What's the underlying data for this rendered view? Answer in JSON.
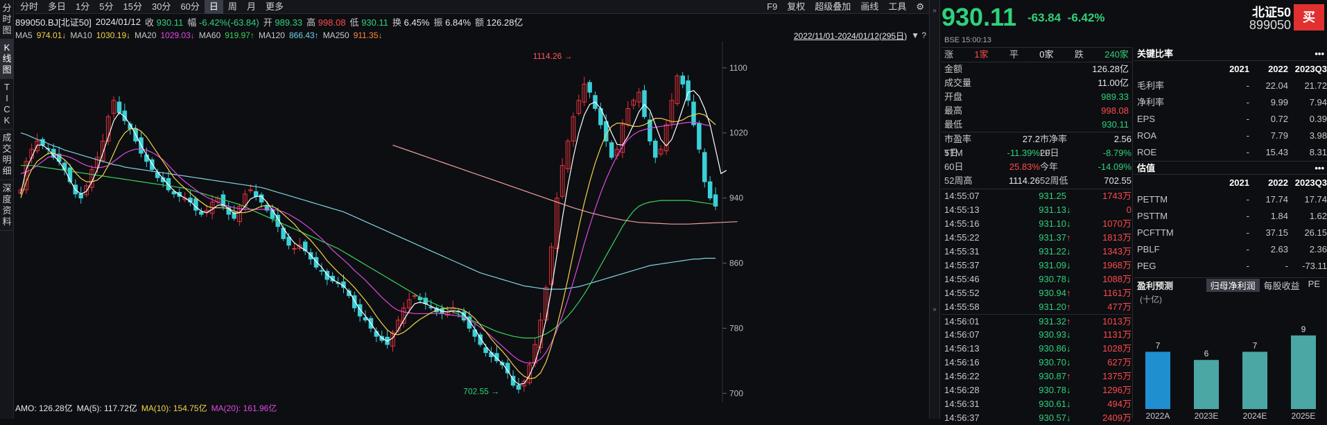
{
  "toolbar": {
    "periods": [
      "分时",
      "多日",
      "1分",
      "5分",
      "15分",
      "30分",
      "60分",
      "日",
      "周",
      "月",
      "更多"
    ],
    "active_period": "日",
    "right": [
      "F9",
      "复权",
      "超级叠加",
      "画线",
      "工具"
    ]
  },
  "leftnav": [
    "分时图",
    "K线图",
    "TICK",
    "成交明细",
    "深度资料"
  ],
  "info": {
    "code_name": "899050.BJ[北证50]",
    "date": "2024/01/12",
    "close_label": "收",
    "close": "930.11",
    "amp_label": "幅",
    "amp": "-6.42%(-63.84)",
    "open_label": "开",
    "open": "989.33",
    "high_label": "高",
    "high": "998.08",
    "low_label": "低",
    "low": "930.11",
    "turnover_label": "换",
    "turnover": "6.45%",
    "swing_label": "振",
    "swing": "6.84%",
    "amount_label": "额",
    "amount": "126.28亿"
  },
  "ma": {
    "ma5": "MA5",
    "ma5v": "974.01↓",
    "ma10": "MA10",
    "ma10v": "1030.19↓",
    "ma20": "MA20",
    "ma20v": "1029.03↓",
    "ma60": "MA60",
    "ma60v": "919.97↑",
    "ma120": "MA120",
    "ma120v": "866.43↑",
    "ma250": "MA250",
    "ma250v": "911.35↓",
    "range": "2022/11/01-2024/01/12(295日)"
  },
  "chart_data": {
    "type": "candlestick",
    "y_ticks": [
      "1100",
      "1020",
      "940",
      "860",
      "780",
      "700"
    ],
    "ylim": [
      696,
      1122
    ],
    "max_label": "1114.26",
    "min_label": "702.55",
    "closes": [
      950,
      985,
      1000,
      1010,
      1005,
      1000,
      990,
      985,
      975,
      960,
      945,
      940,
      955,
      975,
      990,
      1010,
      1040,
      1060,
      1045,
      1035,
      1025,
      1010,
      995,
      985,
      975,
      965,
      960,
      950,
      945,
      942,
      940,
      935,
      925,
      920,
      925,
      935,
      940,
      930,
      920,
      915,
      930,
      945,
      950,
      942,
      935,
      925,
      915,
      905,
      890,
      882,
      878,
      882,
      875,
      865,
      855,
      850,
      840,
      838,
      835,
      830,
      820,
      805,
      795,
      790,
      780,
      770,
      765,
      760,
      775,
      790,
      805,
      815,
      820,
      815,
      810,
      805,
      800,
      798,
      800,
      805,
      800,
      790,
      780,
      770,
      760,
      750,
      745,
      740,
      735,
      725,
      710,
      705,
      715,
      735,
      760,
      790,
      830,
      880,
      940,
      980,
      1010,
      1040,
      1060,
      1080,
      1070,
      1050,
      1030,
      1010,
      990,
      1000,
      1030,
      1050,
      1060,
      1070,
      1040,
      1010,
      990,
      1000,
      1030,
      1060,
      1090,
      1080,
      1060,
      1030,
      1000,
      960,
      940,
      930
    ],
    "ma5": [
      945,
      975,
      990,
      1005,
      1005,
      1000,
      992,
      985,
      975,
      962,
      950,
      945,
      948,
      960,
      975,
      995,
      1015,
      1035,
      1045,
      1040,
      1030,
      1018,
      1005,
      993,
      982,
      972,
      964,
      956,
      949,
      944,
      940,
      936,
      929,
      924,
      922,
      926,
      931,
      932,
      927,
      921,
      922,
      930,
      939,
      942,
      942,
      935,
      925,
      915,
      903,
      893,
      885,
      880,
      876,
      870,
      862,
      855,
      846,
      840,
      836,
      832,
      825,
      814,
      803,
      795,
      786,
      776,
      768,
      764,
      768,
      778,
      790,
      801,
      810,
      812,
      810,
      807,
      804,
      801,
      800,
      801,
      801,
      797,
      789,
      779,
      768,
      758,
      750,
      743,
      737,
      728,
      717,
      711,
      712,
      722,
      738,
      760,
      790,
      828,
      870,
      915,
      955,
      990,
      1020,
      1042,
      1055,
      1058,
      1050,
      1036,
      1020,
      1006,
      1005,
      1016,
      1030,
      1046,
      1055,
      1048,
      1030,
      1012,
      1004,
      1012,
      1030,
      1050,
      1070,
      1072,
      1065,
      1050,
      1030,
      1000,
      970,
      974
    ],
    "ma10": [
      940,
      960,
      975,
      985,
      990,
      995,
      995,
      992,
      987,
      980,
      971,
      964,
      960,
      960,
      962,
      968,
      980,
      995,
      1010,
      1020,
      1025,
      1026,
      1022,
      1015,
      1005,
      995,
      985,
      975,
      965,
      958,
      952,
      946,
      940,
      935,
      930,
      928,
      928,
      928,
      927,
      924,
      922,
      922,
      924,
      927,
      930,
      931,
      930,
      926,
      920,
      914,
      908,
      900,
      894,
      888,
      880,
      872,
      863,
      856,
      849,
      843,
      837,
      830,
      822,
      814,
      805,
      795,
      786,
      778,
      773,
      772,
      775,
      780,
      786,
      791,
      795,
      799,
      802,
      804,
      805,
      805,
      804,
      802,
      798,
      792,
      784,
      776,
      767,
      759,
      752,
      744,
      735,
      727,
      721,
      718,
      719,
      725,
      738,
      758,
      782,
      810,
      840,
      872,
      904,
      934,
      960,
      983,
      1002,
      1018,
      1028,
      1032,
      1032,
      1030,
      1028,
      1028,
      1030,
      1034,
      1038,
      1038,
      1036,
      1034,
      1034,
      1036,
      1040,
      1042,
      1044,
      1042,
      1036,
      1030
    ],
    "ma20": [
      970,
      972,
      975,
      980,
      985,
      990,
      992,
      993,
      992,
      990,
      987,
      983,
      980,
      978,
      977,
      978,
      980,
      985,
      990,
      995,
      998,
      1000,
      1000,
      999,
      996,
      992,
      987,
      980,
      973,
      966,
      960,
      955,
      950,
      945,
      941,
      938,
      935,
      932,
      930,
      928,
      927,
      926,
      926,
      926,
      926,
      926,
      926,
      925,
      923,
      920,
      916,
      912,
      907,
      902,
      896,
      890,
      883,
      876,
      870,
      864,
      858,
      851,
      845,
      839,
      832,
      825,
      818,
      812,
      806,
      802,
      800,
      799,
      798,
      798,
      798,
      798,
      798,
      798,
      797,
      796,
      795,
      793,
      790,
      786,
      781,
      776,
      770,
      764,
      758,
      752,
      746,
      741,
      738,
      737,
      738,
      742,
      750,
      762,
      777,
      795,
      815,
      837,
      860,
      884,
      906,
      927,
      946,
      963,
      978,
      992,
      1003,
      1012,
      1018,
      1022,
      1024,
      1026,
      1027,
      1028,
      1029,
      1030,
      1031,
      1032,
      1033,
      1033,
      1032,
      1030,
      1029
    ],
    "ma60": [
      980,
      980,
      980,
      979,
      978,
      977,
      976,
      975,
      974,
      973,
      972,
      971,
      970,
      969,
      968,
      967,
      966,
      965,
      964,
      963,
      962,
      961,
      960,
      959,
      958,
      957,
      956,
      955,
      954,
      953,
      952,
      950,
      948,
      946,
      944,
      942,
      940,
      938,
      936,
      934,
      932,
      929,
      926,
      923,
      920,
      917,
      914,
      911,
      908,
      905,
      902,
      899,
      896,
      893,
      890,
      887,
      884,
      881,
      878,
      874,
      870,
      866,
      862,
      858,
      854,
      850,
      846,
      842,
      838,
      834,
      830,
      826,
      822,
      818,
      815,
      812,
      809,
      806,
      803,
      800,
      797,
      794,
      791,
      788,
      785,
      782,
      779,
      776,
      774,
      772,
      770,
      769,
      768,
      768,
      768,
      770,
      773,
      777,
      782,
      788,
      795,
      803,
      812,
      822,
      833,
      845,
      857,
      869,
      881,
      893,
      905,
      915,
      924,
      930,
      933,
      935,
      936,
      937,
      937,
      937,
      937,
      937,
      937,
      936,
      935,
      934,
      933,
      932
    ],
    "ma120": [
      1020,
      1018,
      1015,
      1012,
      1010,
      1007,
      1004,
      1002,
      999,
      997,
      995,
      993,
      991,
      989,
      987,
      985,
      983,
      981,
      980,
      978,
      977,
      976,
      975,
      974,
      973,
      972,
      971,
      970,
      969,
      968,
      967,
      966,
      965,
      964,
      963,
      962,
      961,
      960,
      959,
      958,
      957,
      956,
      955,
      954,
      953,
      951,
      949,
      947,
      945,
      943,
      941,
      939,
      937,
      935,
      933,
      931,
      929,
      927,
      925,
      923,
      920,
      917,
      914,
      911,
      908,
      905,
      902,
      899,
      896,
      893,
      890,
      887,
      884,
      881,
      878,
      875,
      872,
      869,
      866,
      863,
      860,
      857,
      854,
      851,
      848,
      846,
      844,
      842,
      840,
      838,
      836,
      834,
      832,
      831,
      830,
      829,
      828,
      828,
      828,
      828,
      829,
      830,
      831,
      833,
      835,
      837,
      839,
      841,
      843,
      845,
      847,
      849,
      851,
      853,
      855,
      857,
      858,
      859,
      860,
      861,
      862,
      863,
      864,
      865,
      865,
      866,
      866,
      866
    ],
    "ma250": [
      null,
      null,
      null,
      null,
      null,
      null,
      null,
      null,
      null,
      null,
      null,
      null,
      null,
      null,
      null,
      null,
      null,
      null,
      null,
      null,
      null,
      null,
      null,
      null,
      null,
      null,
      null,
      null,
      null,
      null,
      null,
      null,
      null,
      null,
      null,
      null,
      null,
      null,
      null,
      null,
      null,
      null,
      null,
      null,
      null,
      null,
      null,
      null,
      null,
      null,
      null,
      null,
      null,
      null,
      null,
      null,
      null,
      null,
      null,
      null,
      null,
      null,
      null,
      null,
      null,
      null,
      null,
      null,
      null,
      null,
      null,
      null,
      null,
      null,
      null,
      null,
      null,
      null,
      null,
      null,
      null,
      null,
      null,
      null,
      null,
      null,
      null,
      null,
      null,
      null,
      null,
      null,
      null,
      null,
      null,
      null,
      null,
      null,
      null,
      null,
      null,
      null,
      null,
      null,
      null,
      null,
      null,
      null,
      null,
      null,
      null,
      null,
      null,
      null,
      null,
      null,
      null,
      null,
      null,
      null,
      null,
      null,
      null,
      null,
      null,
      null,
      null,
      null
    ],
    "ma250_line": [
      1005,
      998,
      991,
      984,
      977,
      970,
      963,
      956,
      949,
      942,
      935,
      928,
      922,
      917,
      913,
      910,
      909,
      908,
      908,
      909,
      910,
      911
    ]
  },
  "amo": {
    "amo": "AMO: 126.28亿",
    "ma5": "MA(5): 117.72亿",
    "ma10": "MA(10): 154.75亿",
    "ma20": "MA(20): 161.96亿"
  },
  "quote": {
    "price": "930.11",
    "change": "-63.84",
    "pct": "-6.42%",
    "name": "北证50",
    "code": "899050",
    "buy": "买",
    "exchange": "BSE",
    "time": "15:00:13"
  },
  "stats": {
    "up_label": "涨",
    "up": "1家",
    "flat_label": "平",
    "flat": "0家",
    "down_label": "跌",
    "down": "240家",
    "rows": [
      {
        "k": "金额",
        "v": "126.28亿",
        "c": "white"
      },
      {
        "k": "成交量",
        "v": "11.00亿",
        "c": "white"
      },
      {
        "k": "开盘",
        "v": "989.33",
        "c": "green"
      },
      {
        "k": "最高",
        "v": "998.08",
        "c": "red"
      },
      {
        "k": "最低",
        "v": "930.11",
        "c": "green"
      }
    ],
    "grid": [
      [
        "市盈率TTM",
        "27.2",
        "市净率LF",
        "2.56",
        "white",
        "white"
      ],
      [
        "5日",
        "-11.39%",
        "20日",
        "-8.79%",
        "green",
        "green"
      ],
      [
        "60日",
        "25.83%",
        "今年",
        "-14.09%",
        "red",
        "green"
      ],
      [
        "52周高",
        "1114.26",
        "52周低",
        "702.55",
        "white",
        "white"
      ]
    ]
  },
  "ticks": [
    [
      "14:55:07",
      "931.25",
      "",
      "1743万"
    ],
    [
      "14:55:13",
      "931.13",
      "↓",
      "0"
    ],
    [
      "14:55:16",
      "931.10",
      "↓",
      "1070万"
    ],
    [
      "14:55:22",
      "931.37",
      "↑",
      "1813万"
    ],
    [
      "14:55:31",
      "931.22",
      "↓",
      "1343万"
    ],
    [
      "14:55:37",
      "931.09",
      "↓",
      "1968万"
    ],
    [
      "14:55:46",
      "930.78",
      "↓",
      "1088万"
    ],
    [
      "14:55:52",
      "930.94",
      "↑",
      "1161万"
    ],
    [
      "14:55:58",
      "931.20",
      "↑",
      "477万"
    ],
    [
      "14:56:01",
      "931.32",
      "↑",
      "1013万"
    ],
    [
      "14:56:07",
      "930.93",
      "↓",
      "1131万"
    ],
    [
      "14:56:13",
      "930.86",
      "↓",
      "1028万"
    ],
    [
      "14:56:16",
      "930.70",
      "↓",
      "627万"
    ],
    [
      "14:56:22",
      "930.87",
      "↑",
      "1375万"
    ],
    [
      "14:56:28",
      "930.78",
      "↓",
      "1296万"
    ],
    [
      "14:56:31",
      "930.61",
      "↓",
      "494万"
    ],
    [
      "14:56:37",
      "930.57",
      "↓",
      "2409万"
    ]
  ],
  "key_ratios": {
    "title": "关键比率",
    "more": "•••",
    "header": [
      "",
      "2021",
      "2022",
      "2023Q3"
    ],
    "rows": [
      [
        "毛利率",
        "-",
        "22.04",
        "21.72"
      ],
      [
        "净利率",
        "-",
        "9.99",
        "7.94"
      ],
      [
        "EPS",
        "-",
        "0.72",
        "0.39"
      ],
      [
        "ROA",
        "-",
        "7.79",
        "3.98"
      ],
      [
        "ROE",
        "-",
        "15.43",
        "8.31"
      ]
    ]
  },
  "valuation": {
    "title": "估值",
    "more": "•••",
    "header": [
      "",
      "2021",
      "2022",
      "2023Q3"
    ],
    "rows": [
      [
        "PETTM",
        "-",
        "17.74",
        "17.74"
      ],
      [
        "PSTTM",
        "-",
        "1.84",
        "1.62"
      ],
      [
        "PCFTTM",
        "-",
        "37.15",
        "26.15"
      ],
      [
        "PBLF",
        "-",
        "2.63",
        "2.36"
      ],
      [
        "PEG",
        "-",
        "-",
        "-73.11"
      ]
    ]
  },
  "forecast": {
    "title": "盈利预测",
    "tabs": [
      "归母净利润",
      "每股收益",
      "PE"
    ],
    "active": "归母净利润",
    "unit": "(十亿)",
    "bars": [
      {
        "label": "2022A",
        "value": 7,
        "color": "#1f8fd0"
      },
      {
        "label": "2023E",
        "value": 6,
        "color": "#4aa7a3"
      },
      {
        "label": "2024E",
        "value": 7,
        "color": "#4aa7a3"
      },
      {
        "label": "2025E",
        "value": 9,
        "color": "#4aa7a3"
      }
    ]
  }
}
